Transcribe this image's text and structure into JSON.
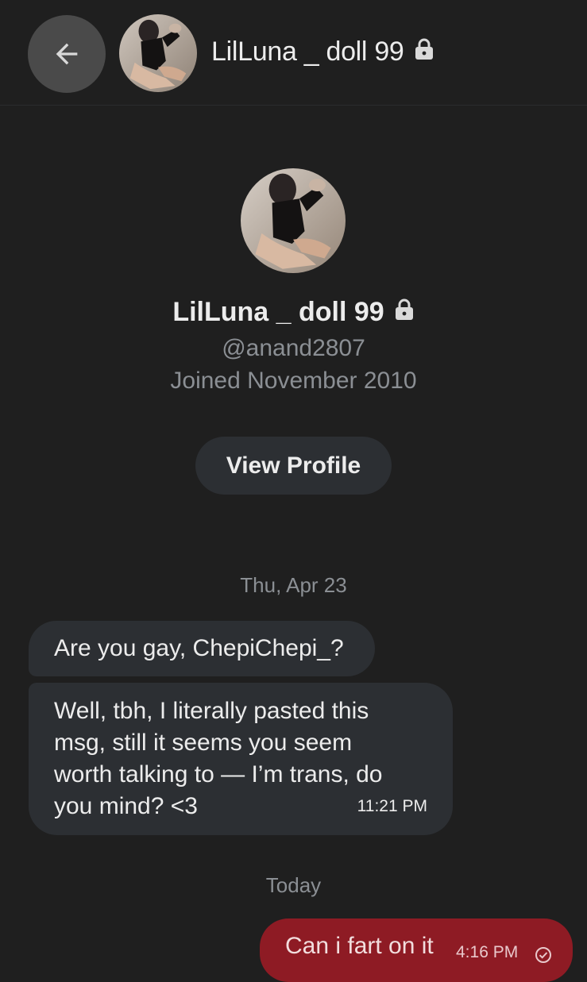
{
  "header": {
    "back_icon": "arrow-left-icon",
    "name": "LilLuna _ doll 99",
    "lock_icon": "lock-icon"
  },
  "profile": {
    "name": "LilLuna _ doll 99",
    "handle": "@anand2807",
    "joined": "Joined November 2010",
    "view_profile_label": "View Profile"
  },
  "conversation": {
    "divider_1": "Thu, Apr 23",
    "messages_in": [
      {
        "text": "Are you gay, ChepiChepi_?"
      },
      {
        "text": "Well, tbh, I literally pasted this msg, still it seems you seem worth talking to — I’m trans, do you mind? <3",
        "time": "11:21 PM"
      }
    ],
    "divider_2": "Today",
    "message_out": {
      "text": "Can i fart on it",
      "time": "4:16 PM",
      "status_icon": "sent-check-icon"
    }
  },
  "colors": {
    "background": "#1f1f1f",
    "incoming_bubble": "#2c2f33",
    "outgoing_bubble": "#8e1b24",
    "secondary_text": "#8b8f94"
  }
}
